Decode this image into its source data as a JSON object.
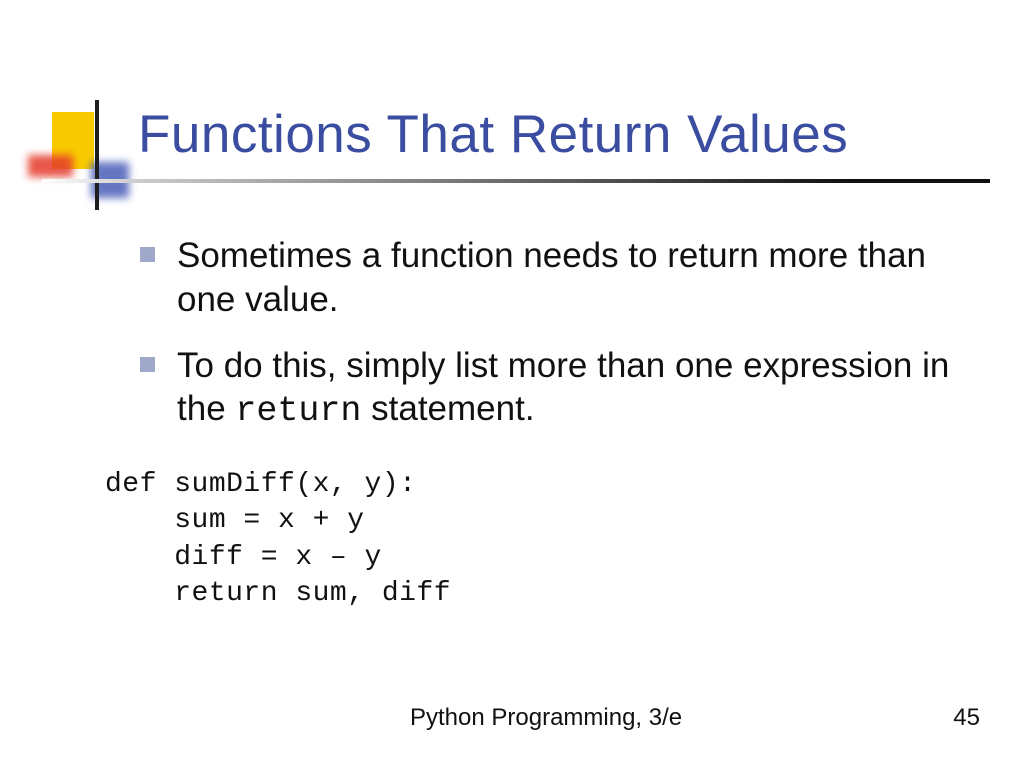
{
  "slide": {
    "title": "Functions That Return Values",
    "bullets": [
      {
        "parts": [
          "Sometimes a function needs to return more than one value."
        ]
      },
      {
        "parts": [
          "To do this, simply list more than one expression in the ",
          "return",
          " statement."
        ]
      }
    ],
    "code": "def sumDiff(x, y):\n    sum = x + y\n    diff = x – y\n    return sum, diff",
    "footer_center": "Python Programming, 3/e",
    "footer_page": "45"
  }
}
